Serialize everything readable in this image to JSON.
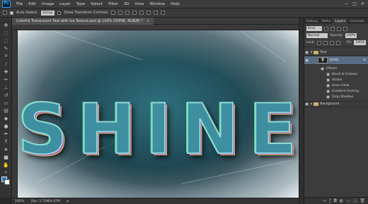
{
  "app": {
    "logo": "Ps",
    "accent": "#31a8ff"
  },
  "menu": [
    "File",
    "Edit",
    "Image",
    "Layer",
    "Type",
    "Select",
    "Filter",
    "3D",
    "View",
    "Window",
    "Help"
  ],
  "window_controls": [
    "—",
    "□",
    "✕"
  ],
  "options_bar": {
    "auto_select_label": "Auto-Select:",
    "auto_select_value": "Group",
    "show_transform_label": "Show Transform Controls"
  },
  "document": {
    "tab_title": "Colorful Translucent Text with Ice Texture.psd @ 100% (SHINE, RGB/8) *",
    "canvas_text": "SHINE"
  },
  "status": {
    "zoom": "100%",
    "doc_size": "Doc: 1.72M/4.67M"
  },
  "panel": {
    "tabs": [
      "History",
      "Paths",
      "Layers",
      "Channels"
    ],
    "active_tab": "Layers",
    "kind_label": "Kind",
    "blend_mode": "Normal",
    "opacity_label": "Opacity:",
    "opacity_value": "100%",
    "lock_label": "Lock:",
    "fill_label": "Fill:",
    "fill_value": "100%",
    "layers": {
      "group_text": "Text",
      "shine_layer": "SHINE",
      "shine_fx": "fx",
      "effects_label": "Effects",
      "effects": [
        "Bevel & Emboss",
        "Stroke",
        "Inner Glow",
        "Gradient Overlay",
        "Drop Shadow"
      ],
      "background_group": "Background"
    }
  },
  "tools": [
    "move",
    "marquee",
    "lasso",
    "quick-select",
    "crop",
    "eyedropper",
    "healing",
    "brush",
    "clone",
    "history-brush",
    "eraser",
    "gradient",
    "blur",
    "dodge",
    "pen",
    "type",
    "path-select",
    "shape",
    "hand",
    "zoom"
  ],
  "colors": {
    "foreground": "#2a7fd0",
    "background": "#ffffff",
    "text_fill": "#3e8fa0"
  }
}
